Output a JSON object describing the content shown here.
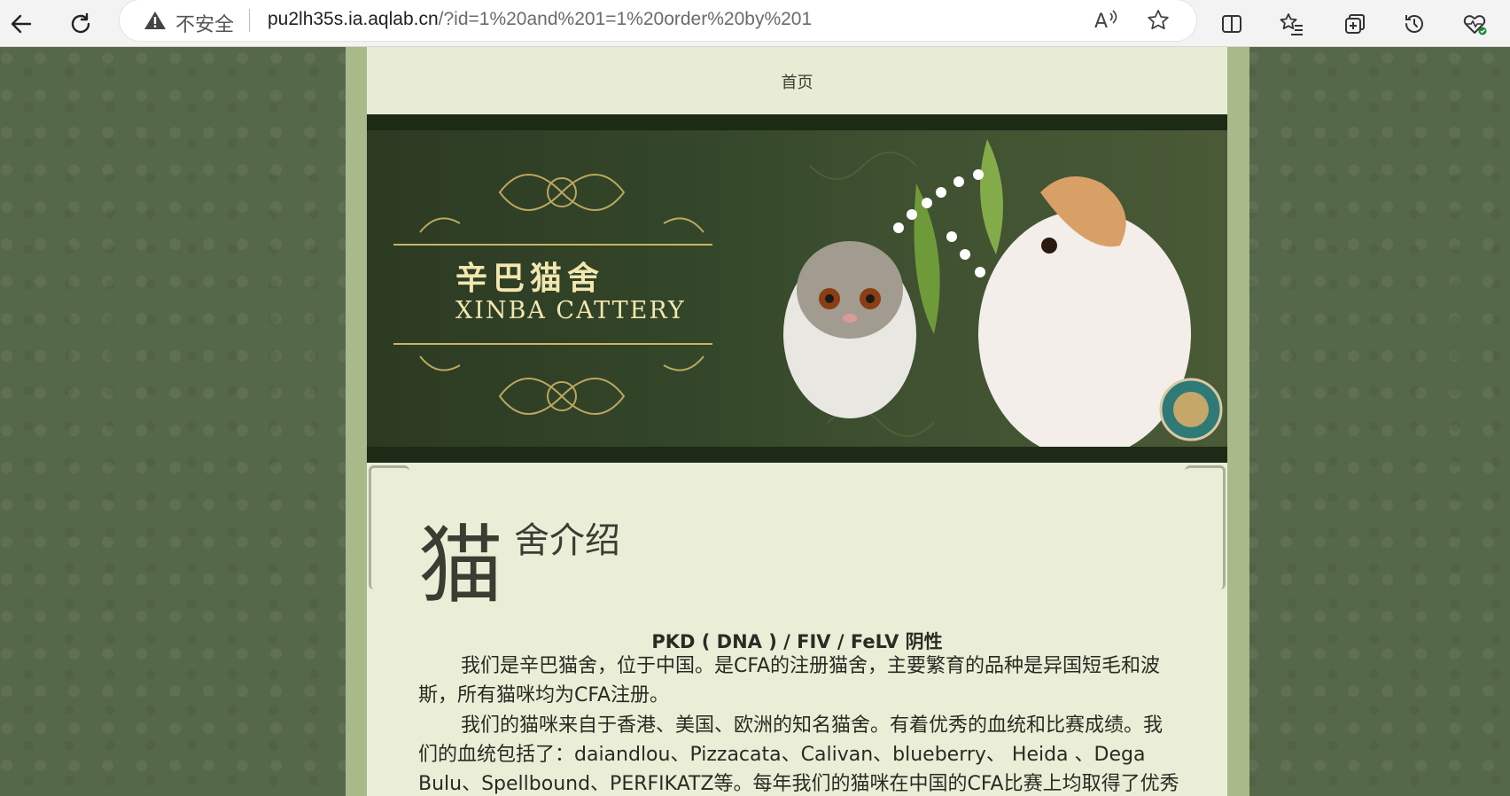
{
  "browser": {
    "security_label": "不安全",
    "url_host": "pu2lh35s.ia.aqlab.cn",
    "url_rest": "/?id=1%20and%201=1%20order%20by%201"
  },
  "nav": {
    "home": "首页"
  },
  "banner": {
    "title_cn": "辛巴猫舍",
    "title_en": "XINBA CATTERY"
  },
  "content": {
    "heading_big": "猫",
    "heading_rest": "舍介绍",
    "pkd_line": "PKD ( DNA ) / FIV / FeLV 阴性",
    "paragraph_1": "我们是辛巴猫舍，位于中国。是CFA的注册猫舍，主要繁育的品种是异国短毛和波斯，所有猫咪均为CFA注册。",
    "paragraph_2": "我们的猫咪来自于香港、美国、欧洲的知名猫舍。有着优秀的血统和比赛成绩。我们的血统包括了：daiandlou、Pizzacata、Calivan、blueberry、 Heida 、Dega Bulu、Spellbound、PERFIKATZ等。每年我们的猫咪在中国的CFA比赛上均取得了优秀"
  }
}
